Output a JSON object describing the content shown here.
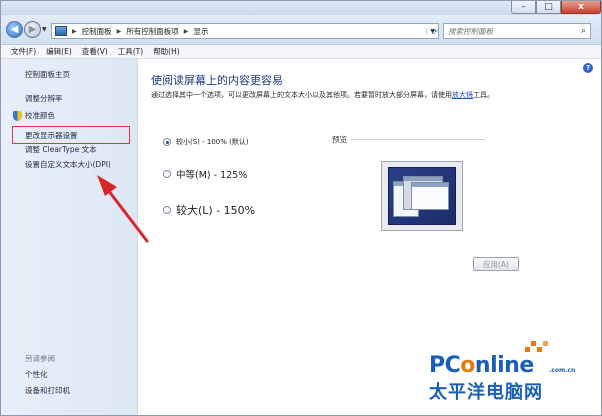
{
  "caption": {
    "minimize_glyph": "–",
    "maximize_glyph": "□",
    "close_glyph": "x"
  },
  "address": {
    "crumbs": [
      "控制面板",
      "所有控制面板项",
      "显示"
    ],
    "search_placeholder": "搜索控制面板"
  },
  "menu": {
    "items": [
      "文件(F)",
      "编辑(E)",
      "查看(V)",
      "工具(T)",
      "帮助(H)"
    ]
  },
  "sidebar": {
    "home": "控制面板主页",
    "items": [
      "调整分辨率",
      "校准颜色",
      "更改显示器设置",
      "调整 ClearType 文本",
      "设置自定义文本大小(DPI)"
    ],
    "see_also_title": "另请参阅",
    "see_also": [
      "个性化",
      "设备和打印机"
    ]
  },
  "main": {
    "title": "使阅读屏幕上的内容更容易",
    "desc_prefix": "通过选择其中一个选项，可以更改屏幕上的文本大小以及其他项。若要暂时放大部分屏幕，请使用",
    "desc_link": "放大镜",
    "desc_suffix": "工具。",
    "options": [
      {
        "label": "较小(S) - 100% (默认)",
        "selected": true
      },
      {
        "label": "中等(M) - 125%",
        "selected": false
      },
      {
        "label": "较大(L) - 150%",
        "selected": false
      }
    ],
    "preview_label": "预览",
    "apply_label": "应用(A)"
  },
  "watermark": {
    "brand_pre": "PC",
    "brand_o": "o",
    "brand_post": "nline",
    "domain": ".com.cn",
    "cn_name": "太平洋电脑网"
  },
  "colors": {
    "title_blue": "#1c3d80",
    "highlight_red": "#d93a3a",
    "brand_blue": "#1a5fb5",
    "brand_orange": "#e47b12"
  }
}
